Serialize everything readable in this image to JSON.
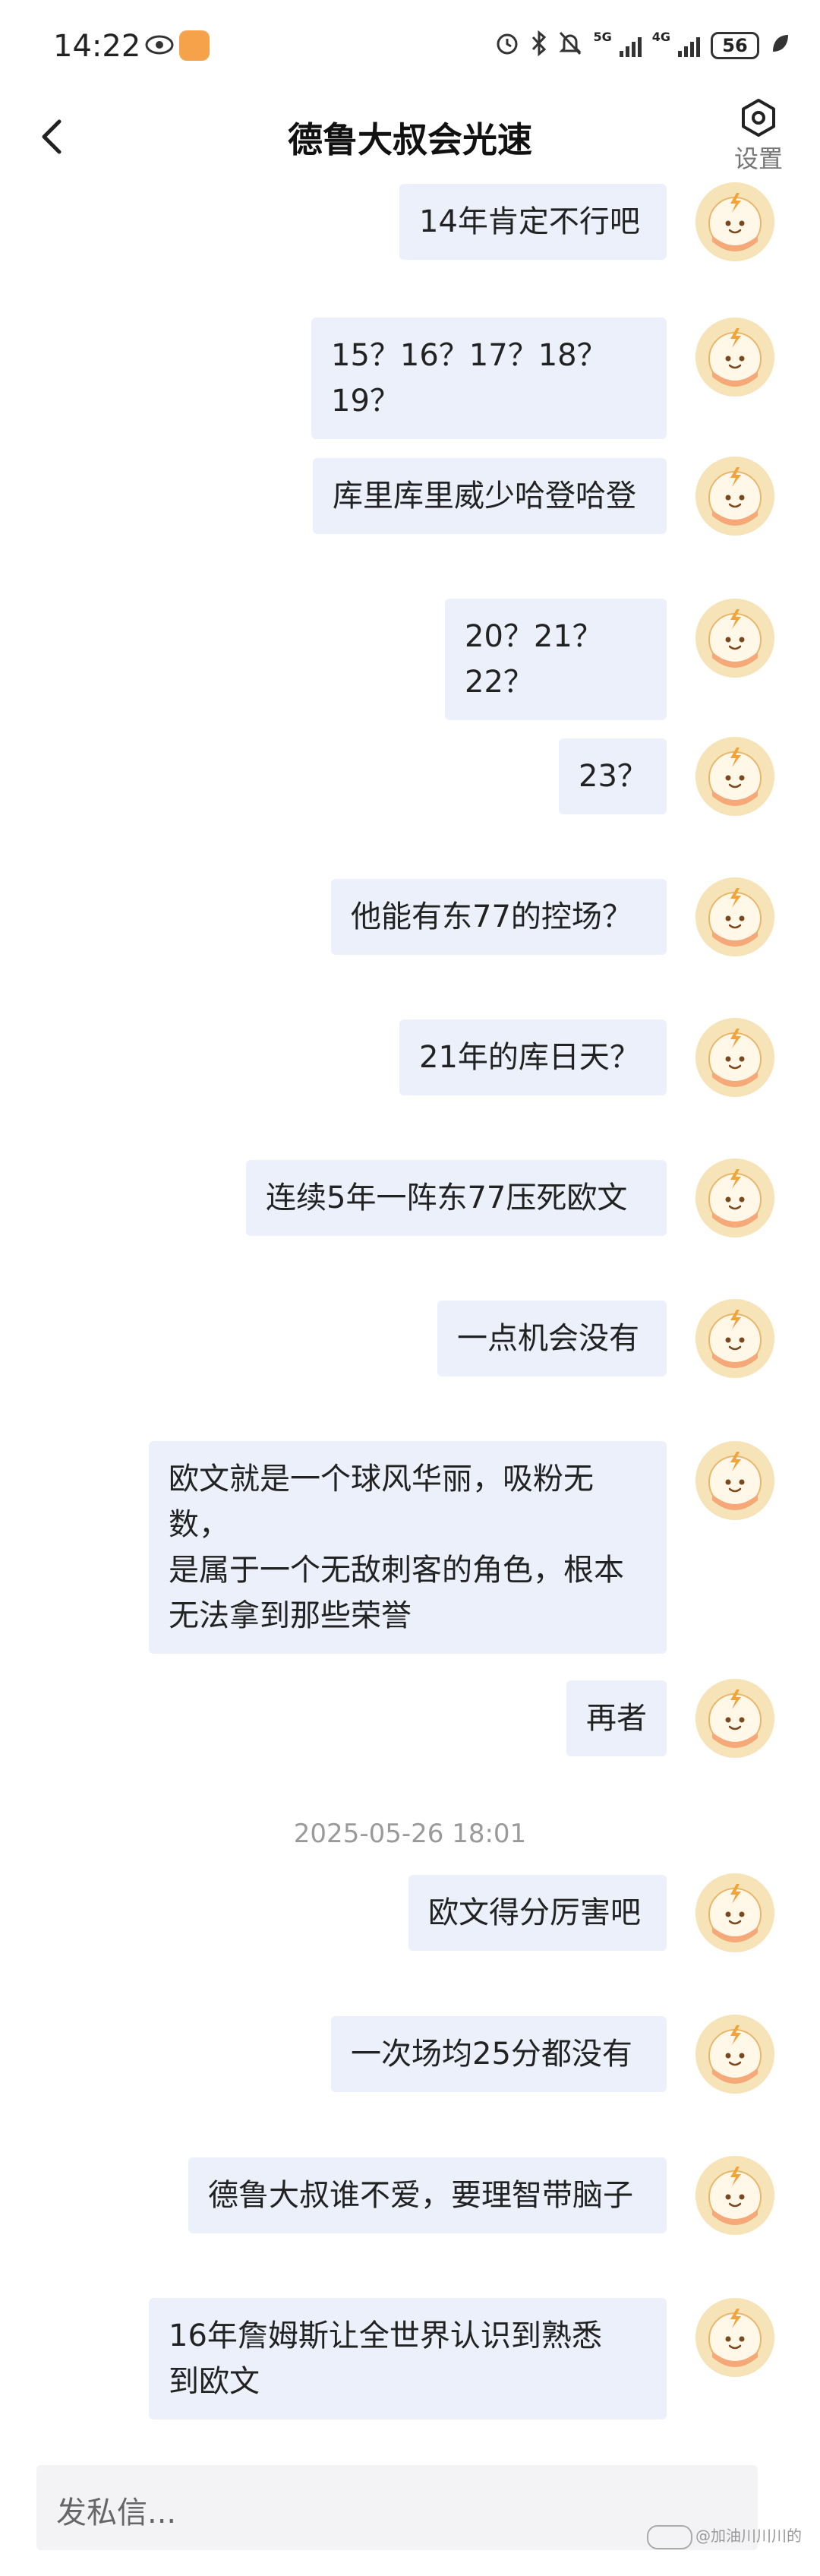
{
  "status_bar": {
    "time": "14:22",
    "battery": "56",
    "net1": "5G",
    "net2": "4G"
  },
  "header": {
    "title": "德鲁大叔会光速",
    "settings_label": "设置"
  },
  "messages": [
    {
      "text": "14年肯定不行吧"
    },
    {
      "text": "15？16？17？18？19？"
    },
    {
      "text": "库里库里威少哈登哈登"
    },
    {
      "text": "20？21？22？"
    },
    {
      "text": "23？"
    },
    {
      "text": "他能有东77的控场？"
    },
    {
      "text": "21年的库日天？"
    },
    {
      "text": "连续5年一阵东77压死欧文"
    },
    {
      "text": "一点机会没有"
    },
    {
      "text": "欧文就是一个球风华丽，吸粉无数，\n是属于一个无敌刺客的角色，根本\n无法拿到那些荣誉"
    },
    {
      "text": "再者"
    },
    {
      "text": "欧文得分厉害吧"
    },
    {
      "text": "一次场均25分都没有"
    },
    {
      "text": "德鲁大叔谁不爱，要理智带脑子"
    },
    {
      "text": "16年詹姆斯让全世界认识到熟悉\n到欧文"
    }
  ],
  "timestamp": "2025-05-26 18:01",
  "input": {
    "placeholder": "发私信..."
  },
  "watermark": "@加油川川川的"
}
